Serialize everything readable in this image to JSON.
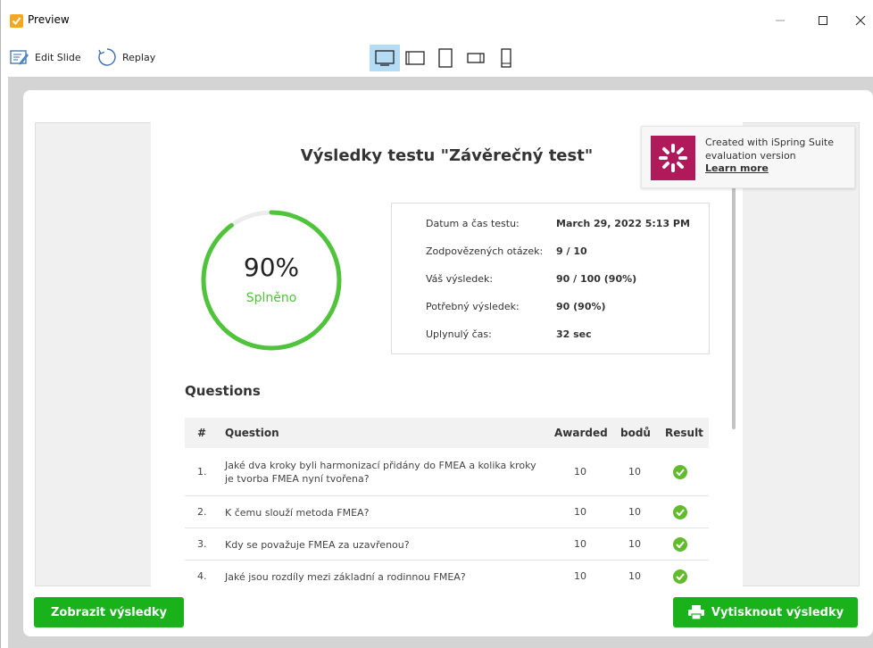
{
  "window": {
    "title": "Preview"
  },
  "toolbar": {
    "edit_label": "Edit Slide",
    "replay_label": "Replay"
  },
  "slide": {
    "title": "Výsledky testu \"Závěrečný test\"",
    "score_percent": "90%",
    "score_fraction": 0.9,
    "status": "Splněno",
    "info": [
      {
        "label": "Datum a čas testu:",
        "value": "March 29, 2022 5:13 PM"
      },
      {
        "label": "Zodpovězených otázek:",
        "value": "9 / 10"
      },
      {
        "label": "Váš výsledek:",
        "value": "90 / 100 (90%)"
      },
      {
        "label": "Potřebný výsledek:",
        "value": "90 (90%)"
      },
      {
        "label": "Uplynulý čas:",
        "value": "32 sec"
      }
    ],
    "questions_heading": "Questions",
    "table": {
      "headers": [
        "#",
        "Question",
        "Awarded",
        "bodů",
        "Result"
      ],
      "rows": [
        {
          "num": "1.",
          "question": "Jaké dva kroky byli harmonizací přidány do FMEA a kolika kroky je tvorba FMEA nyní tvořena?",
          "awarded": "10",
          "points": "10"
        },
        {
          "num": "2.",
          "question": "K čemu slouží metoda FMEA?",
          "awarded": "10",
          "points": "10"
        },
        {
          "num": "3.",
          "question": "Kdy se považuje FMEA za uzavřenou?",
          "awarded": "10",
          "points": "10"
        },
        {
          "num": "4.",
          "question": "Jaké jsou rozdíly mezi základní a rodinnou FMEA?",
          "awarded": "10",
          "points": "10"
        }
      ]
    }
  },
  "notice": {
    "line1": "Created with iSpring Suite",
    "line2": "evaluation version",
    "link": "Learn more"
  },
  "buttons": {
    "show_results": "Zobrazit výsledky",
    "print_results": "Vytisknout výsledky"
  },
  "colors": {
    "accent_green": "#19b21b",
    "ring_green": "#4fc33a",
    "ispring_brand": "#b0195a",
    "device_active": "#b5dcf5"
  }
}
